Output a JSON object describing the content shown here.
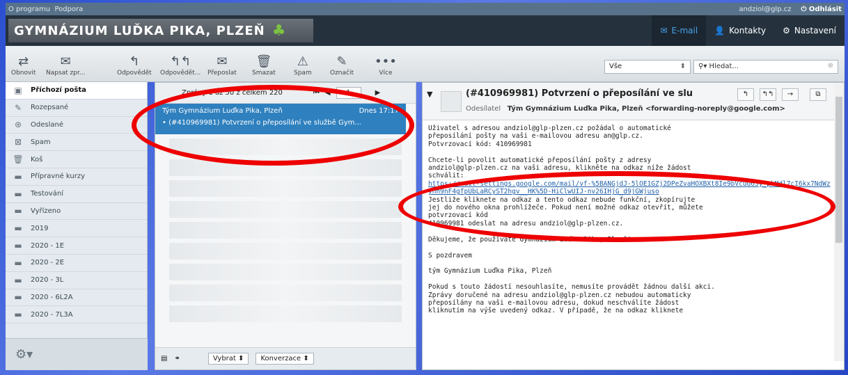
{
  "topbar": {
    "about": "O programu",
    "support": "Podpora",
    "user": "andziol@glp.cz",
    "logout": "Odhlásit"
  },
  "header": {
    "title": "GYMNÁZIUM LUĎKA PIKA, PLZEŇ",
    "nav": [
      {
        "label": "E-mail",
        "icon": "mail-icon"
      },
      {
        "label": "Kontakty",
        "icon": "person-icon"
      },
      {
        "label": "Nastavení",
        "icon": "gear-icon"
      }
    ]
  },
  "toolbar": {
    "refresh": "Obnovit",
    "compose": "Napsat zpr...",
    "reply": "Odpovědět",
    "reply_all": "Odpovědět...",
    "forward": "Přeposlat",
    "delete": "Smazat",
    "spam": "Spam",
    "mark": "Označit",
    "more": "Více"
  },
  "filter": {
    "selected": "Vše"
  },
  "search": {
    "placeholder": "Hledat..."
  },
  "folders": [
    {
      "label": "Příchozí pošta",
      "icon": "inbox-icon"
    },
    {
      "label": "Rozepsané",
      "icon": "pencil-icon"
    },
    {
      "label": "Odeslané",
      "icon": "sent-icon"
    },
    {
      "label": "Spam",
      "icon": "spam-icon"
    },
    {
      "label": "Koš",
      "icon": "trash-icon"
    },
    {
      "label": "Přípravné kurzy",
      "icon": "folder-icon"
    },
    {
      "label": "Testování",
      "icon": "folder-icon"
    },
    {
      "label": "Vyřízeno",
      "icon": "folder-icon"
    },
    {
      "label": "2019",
      "icon": "folder-icon"
    },
    {
      "label": "2020 - 1E",
      "icon": "folder-icon"
    },
    {
      "label": "2020 - 2E",
      "icon": "folder-icon"
    },
    {
      "label": "2020 - 3L",
      "icon": "folder-icon"
    },
    {
      "label": "2020 - 6L2A",
      "icon": "folder-icon"
    },
    {
      "label": "2020 - 7L3A",
      "icon": "folder-icon"
    }
  ],
  "list": {
    "count": "Zprávy 1 až 50 z celkem 220",
    "page": "1",
    "selected": {
      "from": "Tým Gymnázium Luďka Pika, Plzeň",
      "date": "Dnes 17:17",
      "subject": "(#410969981) Potvrzení o přeposílání ve službě Gym..."
    },
    "select_label": "Vybrat",
    "conversation_label": "Konverzace"
  },
  "message": {
    "subject": "(#410969981) Potvrzení o přeposílání ve slu",
    "from_label": "Odesílatel",
    "from": "Tým Gymnázium Luďka Pika, Plzeň <forwarding-noreply@google.com>",
    "body_1": "Uživatel s adresou andziol@glp-plzen.cz požádal o automatické\npřeposílání pošty na vaši e-mailovou adresu an@glp.cz.\nPotvrzovací kód: 410969981\n\nChcete-li povolit automatické přeposílání pošty z adresy\nandziol@glp-plzen.cz na vaši adresu, klikněte na odkaz níže žádost\nschválit:\n",
    "link": "https://mail-settings.google.com/mail/vf-%5BANGjdJ-5lOE1GZj2DPeZvaHOXBXt8Ie9bVcuG6Sy_pkMdl7cI6kx7NdWzynn9nF4gfpUbLaRCyST2hgv__HK%5D-HiClwUIJ-nv26IHjG_d9jGWjuso",
    "body_2": "\nJestliže kliknete na odkaz a tento odkaz nebude funkční, zkopírujte\njej do nového okna prohlížeče. Pokud není možné odkaz otevřít, můžete\npotvrzovací kód\n410969981 odeslat na adresu andziol@glp-plzen.cz.\n\nDěkujeme, že používáte Gymnázium Luďka Pika, Plzeň!\n\nS pozdravem\n\ntým Gymnázium Luďka Pika, Plzeň\n\nPokud s touto žádostí nesouhlasíte, nemusíte provádět žádnou další akci.\nZprávy doručené na adresu andziol@glp-plzen.cz nebudou automaticky\npřeposílány na vaši e-mailovou adresu, dokud neschválíte žádost\nkliknutím na výše uvedený odkaz. V případě, že na odkaz kliknete"
  }
}
